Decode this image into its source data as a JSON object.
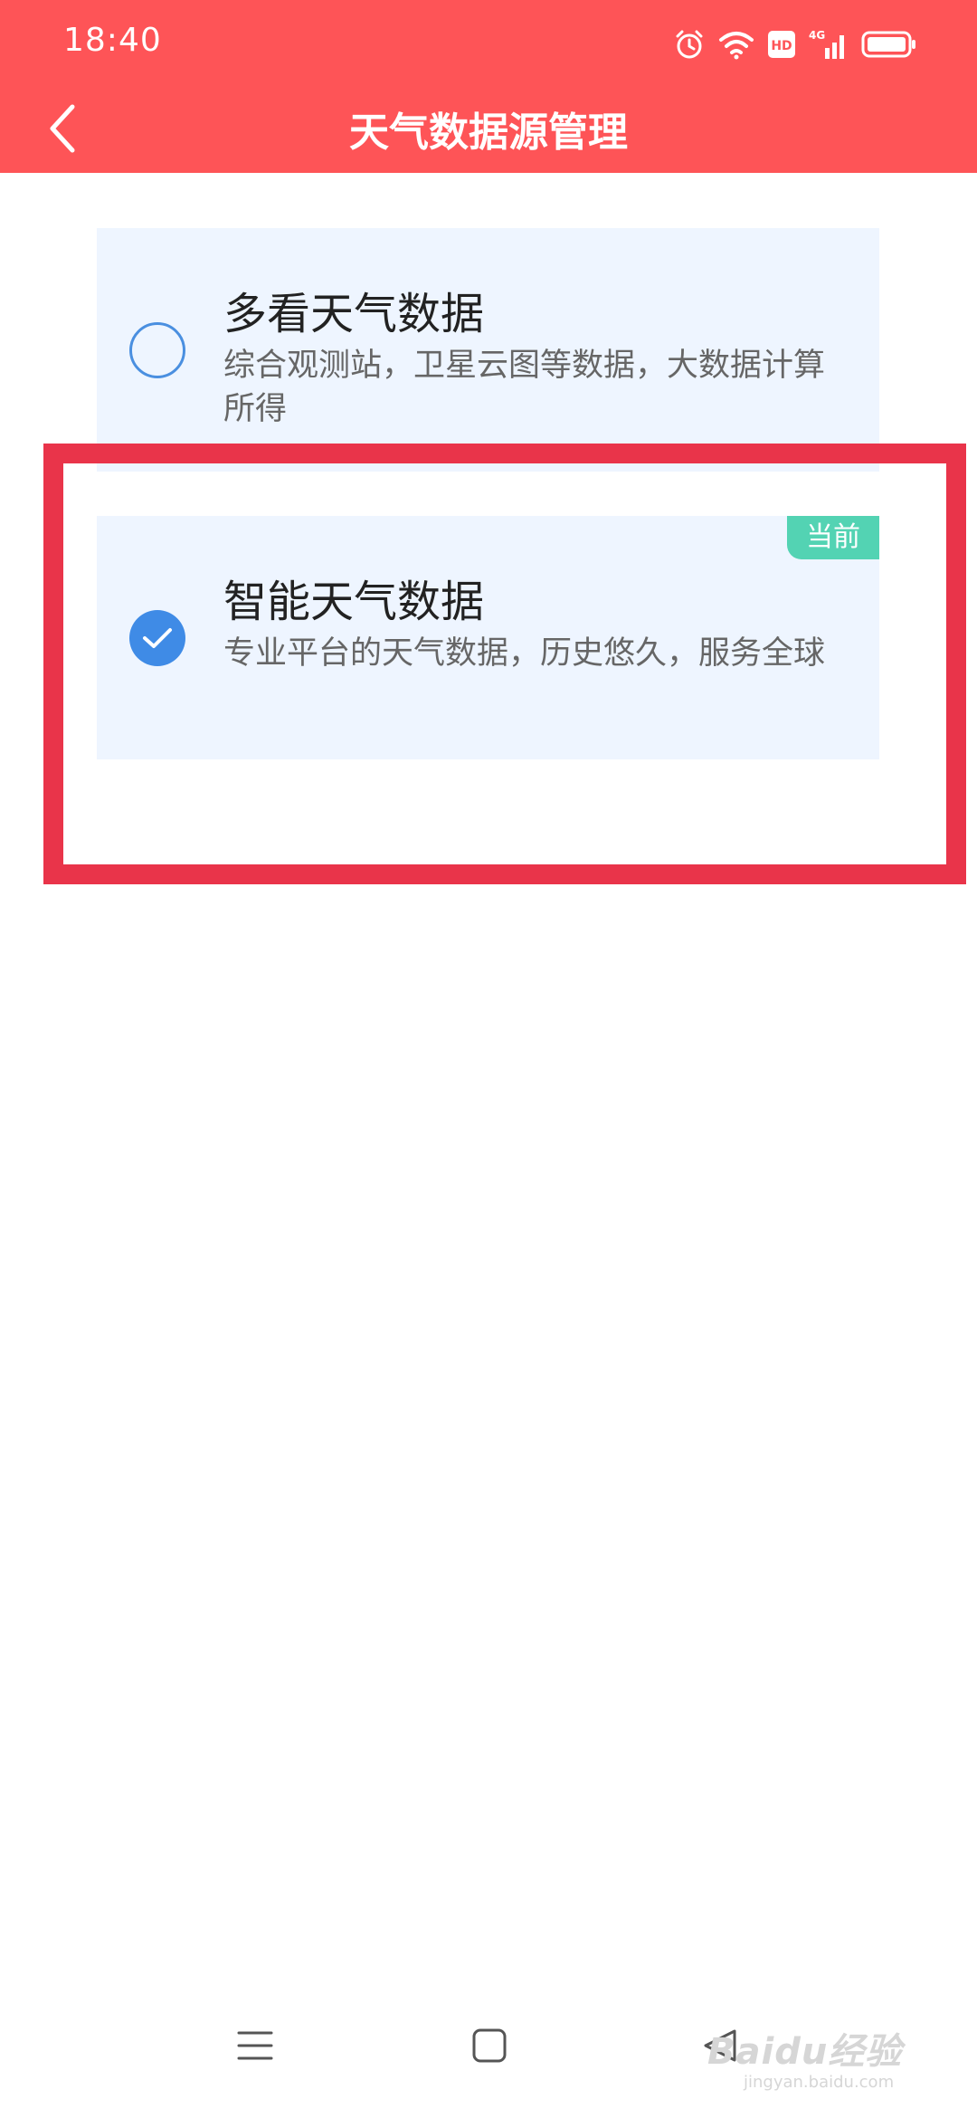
{
  "status_bar": {
    "time": "18:40",
    "icons": [
      "alarm-icon",
      "wifi-icon",
      "hd-icon",
      "signal-4g-icon",
      "battery-icon"
    ],
    "network_label": "4G",
    "hd_label": "HD"
  },
  "header": {
    "title": "天气数据源管理",
    "back_icon": "chevron-left-icon"
  },
  "options": [
    {
      "title": "多看天气数据",
      "description": "综合观测站，卫星云图等数据，大数据计算所得",
      "selected": false
    },
    {
      "title": "智能天气数据",
      "description": "专业平台的天气数据，历史悠久，服务全球",
      "selected": true,
      "badge": "当前"
    }
  ],
  "nav_bar": {
    "icons": [
      "menu-icon",
      "home-icon",
      "back-triangle-icon"
    ]
  },
  "watermark": {
    "text": "Baidu经验",
    "sub": "jingyan.baidu.com"
  },
  "colors": {
    "header_bg": "#fe5457",
    "card_bg": "#eef5ff",
    "radio_blue": "#3f8be6",
    "badge_green": "#53d3b3",
    "highlight_red": "#e9344a"
  }
}
